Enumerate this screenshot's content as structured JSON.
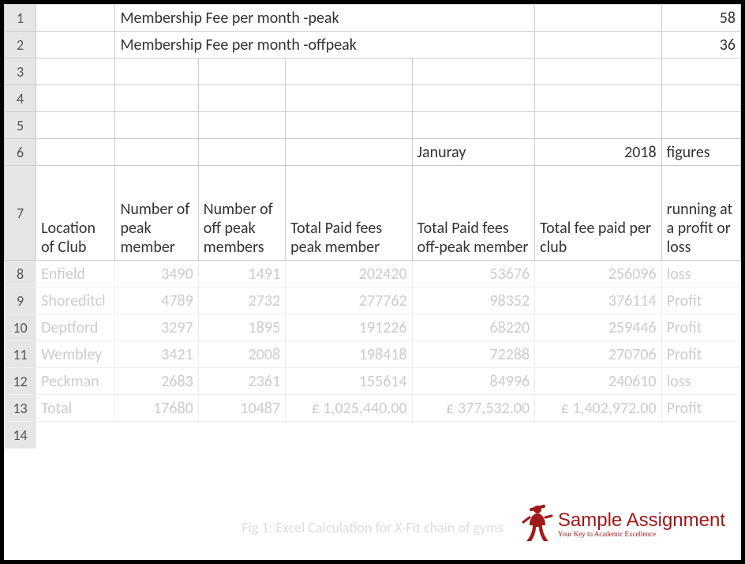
{
  "header_rows": [
    {
      "label": "Membership Fee per month -peak",
      "value": "58"
    },
    {
      "label": "Membership Fee per month -offpeak",
      "value": "36"
    }
  ],
  "year_row": {
    "month": "Januray",
    "year": "2018",
    "figures": "figures"
  },
  "columns": {
    "c1": "Location of Club",
    "c2": "Number of peak member",
    "c3": "Number of off peak members",
    "c4": "Total Paid fees peak member",
    "c5": "Total Paid fees off-peak member",
    "c6": "Total fee paid per club",
    "c7": "running at a profit or loss"
  },
  "data": [
    {
      "loc": "Enfield",
      "peak": "3490",
      "off": "1491",
      "tpeak": "202420",
      "toff": "53676",
      "total": "256096",
      "pl": "loss"
    },
    {
      "loc": "Shoreditcl",
      "peak": "4789",
      "off": "2732",
      "tpeak": "277762",
      "toff": "98352",
      "total": "376114",
      "pl": "Profit"
    },
    {
      "loc": "Deptford",
      "peak": "3297",
      "off": "1895",
      "tpeak": "191226",
      "toff": "68220",
      "total": "259446",
      "pl": "Profit"
    },
    {
      "loc": "Wembley",
      "peak": "3421",
      "off": "2008",
      "tpeak": "198418",
      "toff": "72288",
      "total": "270706",
      "pl": "Profit"
    },
    {
      "loc": "Peckman",
      "peak": "2683",
      "off": "2361",
      "tpeak": "155614",
      "toff": "84996",
      "total": "240610",
      "pl": "loss"
    }
  ],
  "totals": {
    "loc": "Total",
    "peak": "17680",
    "off": "10487",
    "tpeak": "£ 1,025,440.00",
    "toff": "£ 377,532.00",
    "total": "£ 1,402,972.00",
    "pl": "Profit"
  },
  "caption": "Fig 1: Excel Calculation for X-Fit chain of gyms",
  "watermark": {
    "brand": "Sample Assignment",
    "tag": "Your Key to Academic Excellence"
  }
}
